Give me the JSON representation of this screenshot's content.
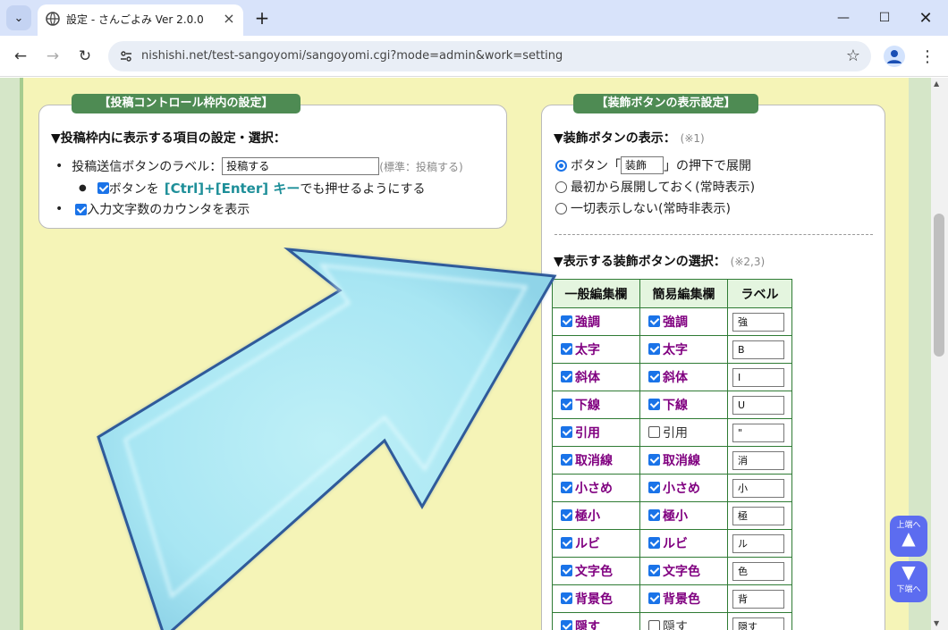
{
  "browser": {
    "tab_title": "設定 - さんごよみ Ver 2.0.0",
    "url": "nishishi.net/test-sangoyomi/sangoyomi.cgi?mode=admin&work=setting"
  },
  "left_box": {
    "heading": "【投稿コントロール枠内の設定】",
    "section_title": "▼投稿枠内に表示する項目の設定・選択：",
    "submit_label_prefix": "投稿送信ボタンのラベル：",
    "submit_label_value": "投稿する",
    "submit_label_note": "(標準：投稿する)",
    "ctrl_enter_prefix": "ボタンを",
    "ctrl_enter_key": "[Ctrl]+[Enter] キー",
    "ctrl_enter_suffix": "でも押せるようにする",
    "counter_label": "入力文字数のカウンタを表示"
  },
  "right_box": {
    "heading": "【装飾ボタンの表示設定】",
    "display_title": "▼装飾ボタンの表示：",
    "display_note": "(※1)",
    "radio1_prefix": "ボタン「",
    "radio1_value": "装飾",
    "radio1_suffix": "」の押下で展開",
    "radio2": "最初から展開しておく(常時表示)",
    "radio3": "一切表示しない(常時非表示)",
    "select_title": "▼表示する装飾ボタンの選択：",
    "select_note": "(※2,3)",
    "table": {
      "headers": [
        "一般編集欄",
        "簡易編集欄",
        "ラベル"
      ],
      "rows": [
        {
          "general": "強調",
          "simple": "強調",
          "simple_checked": true,
          "label": "強"
        },
        {
          "general": "太字",
          "simple": "太字",
          "simple_checked": true,
          "label": "B"
        },
        {
          "general": "斜体",
          "simple": "斜体",
          "simple_checked": true,
          "label": "I"
        },
        {
          "general": "下線",
          "simple": "下線",
          "simple_checked": true,
          "label": "U"
        },
        {
          "general": "引用",
          "simple": "引用",
          "simple_checked": false,
          "label": "\""
        },
        {
          "general": "取消線",
          "simple": "取消線",
          "simple_checked": true,
          "label": "消"
        },
        {
          "general": "小さめ",
          "simple": "小さめ",
          "simple_checked": true,
          "label": "小"
        },
        {
          "general": "極小",
          "simple": "極小",
          "simple_checked": true,
          "label": "極"
        },
        {
          "general": "ルビ",
          "simple": "ルビ",
          "simple_checked": true,
          "label": "ル"
        },
        {
          "general": "文字色",
          "simple": "文字色",
          "simple_checked": true,
          "label": "色"
        },
        {
          "general": "背景色",
          "simple": "背景色",
          "simple_checked": true,
          "label": "背"
        },
        {
          "general": "隠す",
          "simple": "隠す",
          "simple_checked": false,
          "label": "隠す"
        }
      ]
    }
  },
  "jump": {
    "top": "上端へ",
    "bottom": "下端へ"
  },
  "colors": {
    "accent": "#1a73e8",
    "heading_green": "#4e8b53",
    "paper": "#f5f4b7",
    "button_purple": "#800080",
    "arrow": "#a8e8f5"
  }
}
